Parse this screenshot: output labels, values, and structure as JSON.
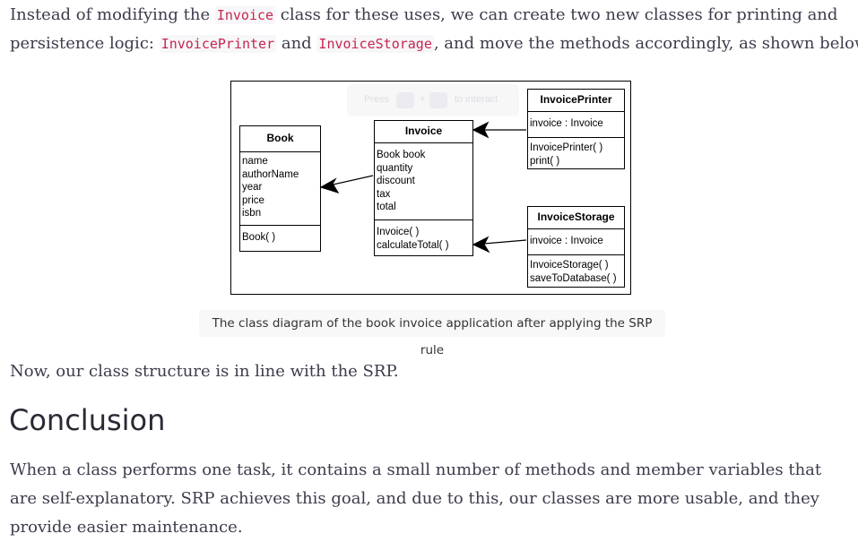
{
  "intro": {
    "part1": "Instead of modifying the ",
    "code1": "Invoice",
    "part2": " class for these uses, we can create two new classes for printing and",
    "part3": "persistence logic: ",
    "code2": "InvoicePrinter",
    "part4": " and ",
    "code3": "InvoiceStorage",
    "part5": ", and move the methods accordingly, as shown below."
  },
  "diagram": {
    "hint": {
      "press": "Press",
      "plus": "+",
      "to_interact": "to interact"
    },
    "book": {
      "title": "Book",
      "fields": [
        "name",
        "authorName",
        "year",
        "price",
        "isbn"
      ],
      "methods": [
        "Book( )"
      ]
    },
    "invoice": {
      "title": "Invoice",
      "fields": [
        "Book book",
        "quantity",
        "discount",
        "tax",
        "total"
      ],
      "methods": [
        "Invoice( )",
        "calculateTotal( )"
      ]
    },
    "printer": {
      "title": "InvoicePrinter",
      "fields": [
        "invoice : Invoice"
      ],
      "methods": [
        "InvoicePrinter( )",
        "print( )"
      ]
    },
    "storage": {
      "title": "InvoiceStorage",
      "fields": [
        "invoice : Invoice"
      ],
      "methods": [
        "InvoiceStorage( )",
        "saveToDatabase( )"
      ]
    }
  },
  "caption": "The class diagram of the book invoice application after applying the SRP rule",
  "para2": "Now, our class structure is in line with the SRP.",
  "heading": "Conclusion",
  "para3": "When a class performs one task, it contains a small number of methods and member variables that are self-explanatory. SRP achieves this goal, and due to this, our classes are more usable, and they provide easier maintenance."
}
